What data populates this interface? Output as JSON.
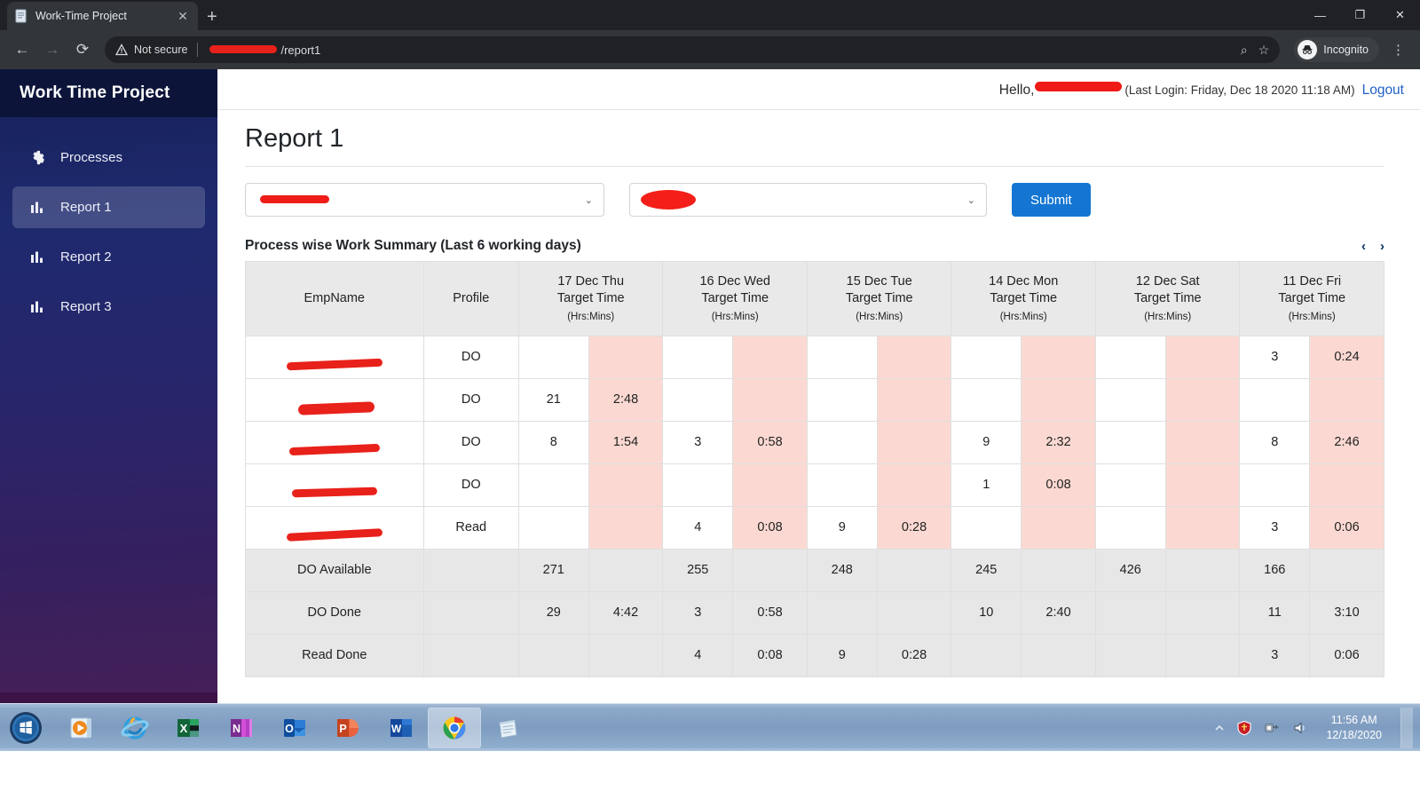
{
  "browser": {
    "tab_title": "Work-Time Project",
    "tab_close_label": "✕",
    "newtab_label": "+",
    "back_label": "←",
    "forward_label": "→",
    "reload_label": "⟳",
    "security_label": "Not secure",
    "url_suffix": "/report1",
    "search_icon_label": "⌕",
    "bookmark_icon_label": "☆",
    "incognito_label": "Incognito",
    "menu_label": "⋮",
    "minimize_label": "—",
    "maximize_label": "❐",
    "close_label": "✕"
  },
  "sidebar": {
    "brand": "Work Time Project",
    "items": [
      {
        "label": "Processes",
        "icon": "gear-icon",
        "active": false
      },
      {
        "label": "Report 1",
        "icon": "bar-chart-icon",
        "active": true
      },
      {
        "label": "Report 2",
        "icon": "bar-chart-icon",
        "active": false
      },
      {
        "label": "Report 3",
        "icon": "bar-chart-icon",
        "active": false
      }
    ]
  },
  "topbar": {
    "greeting": "Hello,",
    "username": "",
    "last_login": "(Last Login: Friday, Dec 18 2020 11:18 AM)",
    "logout": "Logout"
  },
  "page": {
    "title": "Report 1"
  },
  "filters": {
    "process_select_value": "",
    "process_select_caret": "⌄",
    "second_select_value": "",
    "second_select_caret": "⌄",
    "submit_label": "Submit"
  },
  "table_section": {
    "title": "Process wise Work Summary (Last 6 working days)",
    "prev_label": "‹",
    "next_label": "›"
  },
  "chart_data": {
    "type": "table",
    "title": "Process wise Work Summary (Last 6 working days)",
    "fixed_headers": [
      "EmpName",
      "Profile"
    ],
    "day_headers": [
      {
        "day": "17 Dec Thu",
        "line2": "Target Time",
        "unit": "(Hrs:Mins)"
      },
      {
        "day": "16 Dec Wed",
        "line2": "Target Time",
        "unit": "(Hrs:Mins)"
      },
      {
        "day": "15 Dec Tue",
        "line2": "Target Time",
        "unit": "(Hrs:Mins)"
      },
      {
        "day": "14 Dec Mon",
        "line2": "Target Time",
        "unit": "(Hrs:Mins)"
      },
      {
        "day": "12 Dec Sat",
        "line2": "Target Time",
        "unit": "(Hrs:Mins)"
      },
      {
        "day": "11 Dec Fri",
        "line2": "Target Time",
        "unit": "(Hrs:Mins)"
      }
    ],
    "rows": [
      {
        "name": "",
        "name_redacted": true,
        "profile": "DO",
        "cells": [
          "",
          "",
          "",
          "",
          "",
          "",
          "",
          "",
          "",
          "",
          "3",
          "0:24"
        ]
      },
      {
        "name": "",
        "name_redacted": true,
        "profile": "DO",
        "cells": [
          "21",
          "2:48",
          "",
          "",
          "",
          "",
          "",
          "",
          "",
          "",
          "",
          ""
        ]
      },
      {
        "name": "",
        "name_redacted": true,
        "profile": "DO",
        "cells": [
          "8",
          "1:54",
          "3",
          "0:58",
          "",
          "",
          "9",
          "2:32",
          "",
          "",
          "8",
          "2:46"
        ]
      },
      {
        "name": "",
        "name_redacted": true,
        "profile": "DO",
        "cells": [
          "",
          "",
          "",
          "",
          "",
          "",
          "1",
          "0:08",
          "",
          "",
          "",
          ""
        ]
      },
      {
        "name": "",
        "name_redacted": true,
        "profile": "Read",
        "cells": [
          "",
          "",
          "4",
          "0:08",
          "9",
          "0:28",
          "",
          "",
          "",
          "",
          "3",
          "0:06"
        ]
      }
    ],
    "summary_rows": [
      {
        "label": "DO Available",
        "profile": "",
        "cells": [
          "271",
          "",
          "255",
          "",
          "248",
          "",
          "245",
          "",
          "426",
          "",
          "166",
          ""
        ]
      },
      {
        "label": "DO Done",
        "profile": "",
        "cells": [
          "29",
          "4:42",
          "3",
          "0:58",
          "",
          "",
          "10",
          "2:40",
          "",
          "",
          "11",
          "3:10"
        ]
      },
      {
        "label": "Read Done",
        "profile": "",
        "cells": [
          "",
          "",
          "4",
          "0:08",
          "9",
          "0:28",
          "",
          "",
          "",
          "",
          "3",
          "0:06"
        ]
      }
    ]
  },
  "taskbar": {
    "start_label": "",
    "items": [
      {
        "name": "media-player-icon",
        "active": false
      },
      {
        "name": "internet-explorer-icon",
        "active": false
      },
      {
        "name": "excel-icon",
        "active": false
      },
      {
        "name": "onenote-icon",
        "active": false
      },
      {
        "name": "outlook-icon",
        "active": false
      },
      {
        "name": "powerpoint-icon",
        "active": false
      },
      {
        "name": "word-icon",
        "active": false
      },
      {
        "name": "chrome-icon",
        "active": true
      },
      {
        "name": "notepad-icon",
        "active": false
      }
    ],
    "tray": {
      "show_hidden_label": "▲",
      "security_icon": "shield-icon",
      "network_icon": "network-icon",
      "volume_icon": "volume-icon"
    },
    "time": "11:56 AM",
    "date": "12/18/2020"
  },
  "colors": {
    "submit_blue": "#1476d2",
    "pink_cell": "#fbd9d2",
    "header_gray": "#e9e9e9",
    "summary_gray": "#e7e7e7",
    "redaction_red": "#e8211a",
    "sidebar_top": "#172059",
    "sidebar_bottom": "#4b1f55"
  }
}
